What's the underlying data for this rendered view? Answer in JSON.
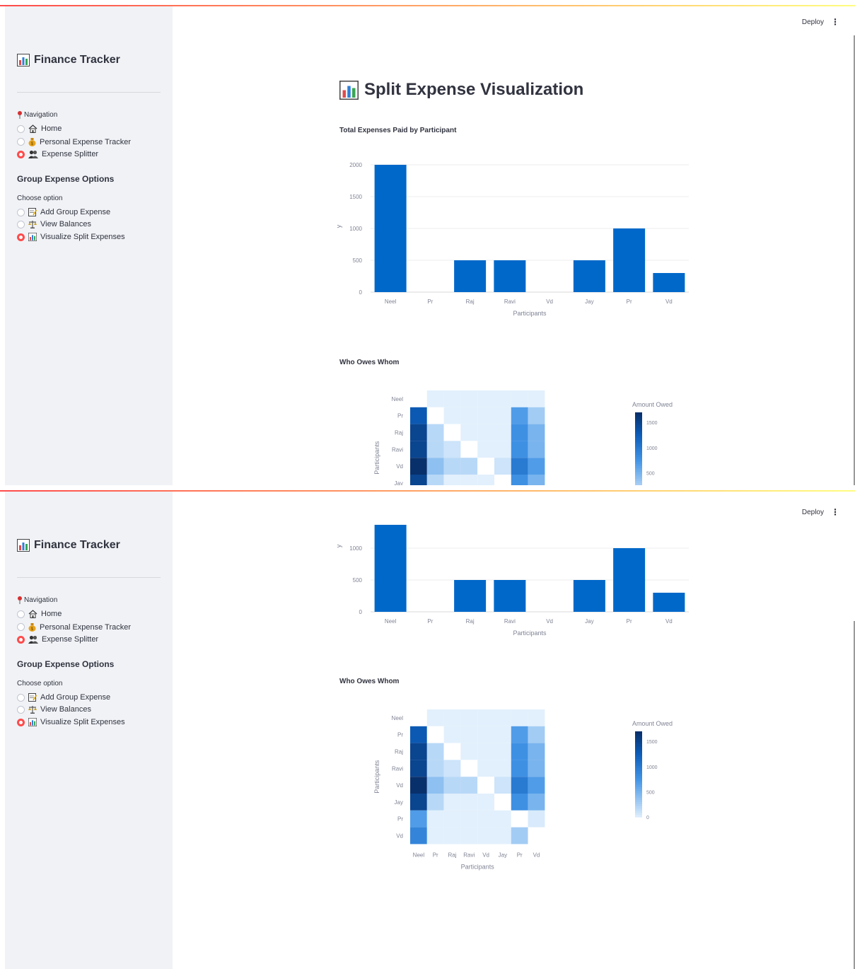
{
  "app": {
    "title": "Finance Tracker",
    "deploy_label": "Deploy",
    "menu_glyph": "⋮"
  },
  "sidebar": {
    "nav_label": "Navigation",
    "nav_items": [
      {
        "label": "Home",
        "icon": "house-icon",
        "selected": false
      },
      {
        "label": "Personal Expense Tracker",
        "icon": "money-bag-icon",
        "selected": false
      },
      {
        "label": "Expense Splitter",
        "icon": "people-icon",
        "selected": true
      }
    ],
    "group_header": "Group Expense Options",
    "choose_label": "Choose option",
    "options": [
      {
        "label": "Add Group Expense",
        "icon": "memo-icon",
        "selected": false
      },
      {
        "label": "View Balances",
        "icon": "scale-icon",
        "selected": false
      },
      {
        "label": "Visualize Split Expenses",
        "icon": "bar-chart-icon",
        "selected": true
      }
    ]
  },
  "main": {
    "title": "Split Expense Visualization",
    "bar_section_title": "Total Expenses Paid by Participant",
    "heatmap_section_title": "Who Owes Whom"
  },
  "colors": {
    "accent": "#ff4b4b",
    "bar": "#0068c9",
    "sidebar_bg": "#f0f2f6",
    "text": "#31333f"
  },
  "chart_data": [
    {
      "type": "bar",
      "categories": [
        "Neel",
        "Pr",
        "Raj",
        "Ravi",
        "Vd",
        "Jay",
        "Pr",
        "Vd"
      ],
      "values": [
        2000,
        0,
        500,
        500,
        0,
        500,
        1000,
        300
      ],
      "xlabel": "Participants",
      "ylabel": "y",
      "yticks": [
        0,
        500,
        1000,
        1500,
        2000
      ],
      "ylim": [
        0,
        2000
      ],
      "grid": true
    },
    {
      "type": "heatmap",
      "rows": [
        "Neel",
        "Pr",
        "Raj",
        "Ravi",
        "Vd",
        "Jay",
        "Pr",
        "Vd"
      ],
      "cols": [
        "Neel",
        "Pr",
        "Raj",
        "Ravi",
        "Vd",
        "Jay",
        "Pr",
        "Vd"
      ],
      "xlabel": "Participants",
      "ylabel": "Participants",
      "colorbar_title": "Amount Owed",
      "colorbar_ticks": [
        0,
        500,
        1000,
        1500
      ],
      "zmax": 1700,
      "values": [
        [
          null,
          0,
          0,
          0,
          0,
          0,
          0,
          0
        ],
        [
          1300,
          null,
          0,
          0,
          0,
          0,
          700,
          300
        ],
        [
          1500,
          200,
          null,
          0,
          0,
          0,
          800,
          500
        ],
        [
          1500,
          200,
          100,
          null,
          0,
          0,
          800,
          500
        ],
        [
          1700,
          400,
          200,
          200,
          null,
          100,
          1000,
          700
        ],
        [
          1500,
          200,
          0,
          0,
          0,
          null,
          800,
          500
        ],
        [
          700,
          0,
          0,
          0,
          0,
          0,
          null,
          50
        ],
        [
          900,
          0,
          0,
          0,
          0,
          0,
          300,
          null
        ]
      ]
    }
  ]
}
